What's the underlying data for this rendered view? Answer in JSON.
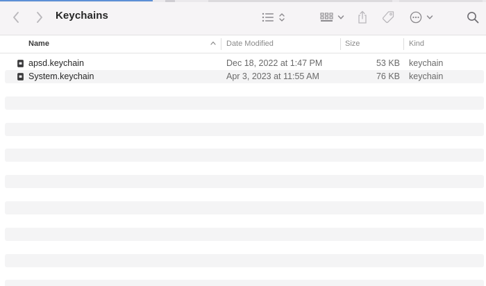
{
  "window": {
    "title": "Keychains"
  },
  "toolbar": {
    "icons": [
      "back-icon",
      "forward-icon",
      "list-view-icon",
      "sort-updown-icon",
      "grid-group-icon",
      "chevron-down-icon",
      "share-icon",
      "tag-icon",
      "more-icon",
      "chevron-down-icon",
      "search-icon"
    ]
  },
  "columns": {
    "name": "Name",
    "date": "Date Modified",
    "size": "Size",
    "kind": "Kind"
  },
  "files": [
    {
      "name": "apsd.keychain",
      "date": "Dec 18, 2022 at 1:47 PM",
      "size": "53 KB",
      "kind": "keychain"
    },
    {
      "name": "System.keychain",
      "date": "Apr 3, 2023 at 11:55 AM",
      "size": "76 KB",
      "kind": "keychain"
    }
  ],
  "colors": {
    "toolbar_bg": "#f6f4f6",
    "stripe": "#f4f4f5",
    "icon": "#8b898d"
  }
}
